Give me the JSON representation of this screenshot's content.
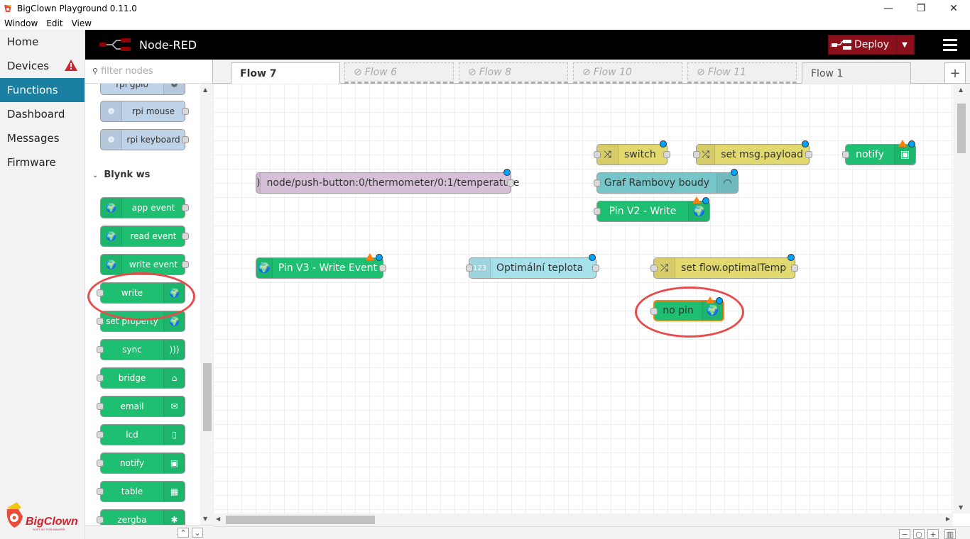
{
  "window": {
    "title": "BigClown Playground 0.11.0",
    "minimize": "—",
    "maximize": "❐",
    "close": "✕"
  },
  "menu": [
    "Window",
    "Edit",
    "View"
  ],
  "nav": {
    "items": [
      {
        "label": "Home"
      },
      {
        "label": "Devices"
      },
      {
        "label": "Functions"
      },
      {
        "label": "Dashboard"
      },
      {
        "label": "Messages"
      },
      {
        "label": "Firmware"
      }
    ],
    "active": "Functions"
  },
  "brand": {
    "name": "BigClown",
    "tagline": "SOFT KIT FOR MAKERS"
  },
  "header": {
    "title": "Node-RED",
    "deploy_label": "Deploy"
  },
  "palette": {
    "search_placeholder": "filter nodes",
    "partial_top": [
      "rpi gpio"
    ],
    "rpi_nodes": [
      "rpi mouse",
      "rpi keyboard"
    ],
    "category": "Blynk ws",
    "blynk_nodes": [
      "app event",
      "read event",
      "write event",
      "write",
      "set property",
      "sync",
      "bridge",
      "email",
      "lcd",
      "notify",
      "table",
      "zergba"
    ]
  },
  "tabs": [
    {
      "label": "Flow 7",
      "state": "active"
    },
    {
      "label": "Flow 6",
      "state": "disabled"
    },
    {
      "label": "Flow 8",
      "state": "disabled"
    },
    {
      "label": "Flow 10",
      "state": "disabled"
    },
    {
      "label": "Flow 11",
      "state": "disabled"
    },
    {
      "label": "Flow 1",
      "state": "normal"
    }
  ],
  "add_tab": "+",
  "flow": {
    "switch": "switch",
    "set_payload": "set msg.payload",
    "notify": "notify",
    "mqtt": "node/push-button:0/thermometer/0:1/temperature",
    "graf": "Graf Rambovy boudy",
    "pin_v2": "Pin V2 - Write",
    "pin_v3": "Pin V3 - Write Event",
    "optimal": "Optimální teplota",
    "set_flow": "set flow.optimalTemp",
    "no_pin": "no pin"
  },
  "zoom": {
    "minus": "−",
    "reset": "○",
    "plus": "+"
  },
  "colors": {
    "accent": "#1a7fa0",
    "deploy": "#8c101c",
    "blynk_green": "#1fbf72",
    "highlight_circle": "#e74c4c"
  }
}
